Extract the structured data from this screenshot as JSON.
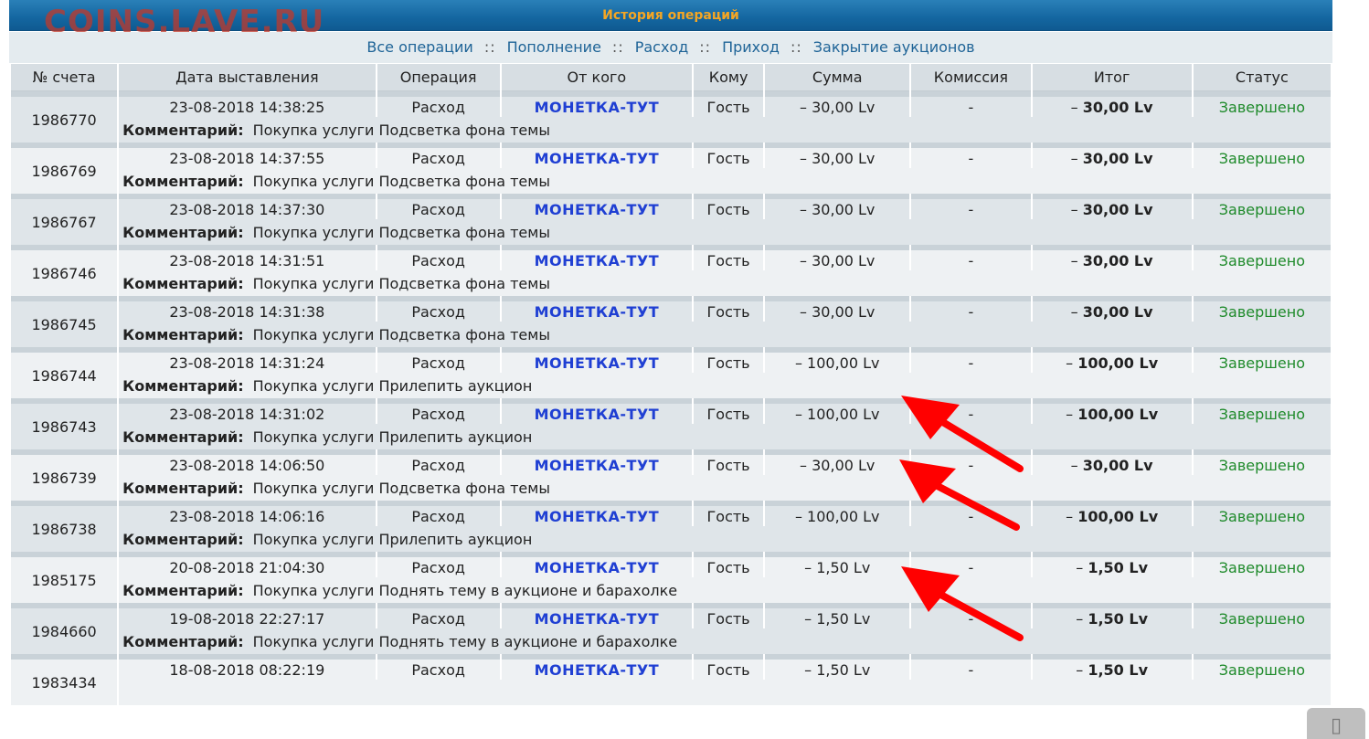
{
  "window": {
    "title": "История операций",
    "watermark": "COINS.LAVE.RU"
  },
  "filters": [
    {
      "label": "Все операции"
    },
    {
      "label": "Пополнение"
    },
    {
      "label": "Расход"
    },
    {
      "label": "Приход"
    },
    {
      "label": "Закрытие аукционов"
    }
  ],
  "filter_separator": "::",
  "columns": [
    "№ счета",
    "Дата выставления",
    "Операция",
    "От кого",
    "Кому",
    "Сумма",
    "Комиссия",
    "Итог",
    "Статус"
  ],
  "comment_label": "Комментарий:",
  "rows": [
    {
      "account": "1986770",
      "date": "23-08-2018 14:38:25",
      "operation": "Расход",
      "from": "МОНЕТКА-ТУТ",
      "to": "Гость",
      "amount": "– 30,00 Lv",
      "fee": "-",
      "total": "– 30,00 Lv",
      "status": "Завершено",
      "comment": "Покупка услуги Подсветка фона темы"
    },
    {
      "account": "1986769",
      "date": "23-08-2018 14:37:55",
      "operation": "Расход",
      "from": "МОНЕТКА-ТУТ",
      "to": "Гость",
      "amount": "– 30,00 Lv",
      "fee": "-",
      "total": "– 30,00 Lv",
      "status": "Завершено",
      "comment": "Покупка услуги Подсветка фона темы"
    },
    {
      "account": "1986767",
      "date": "23-08-2018 14:37:30",
      "operation": "Расход",
      "from": "МОНЕТКА-ТУТ",
      "to": "Гость",
      "amount": "– 30,00 Lv",
      "fee": "-",
      "total": "– 30,00 Lv",
      "status": "Завершено",
      "comment": "Покупка услуги Подсветка фона темы"
    },
    {
      "account": "1986746",
      "date": "23-08-2018 14:31:51",
      "operation": "Расход",
      "from": "МОНЕТКА-ТУТ",
      "to": "Гость",
      "amount": "– 30,00 Lv",
      "fee": "-",
      "total": "– 30,00 Lv",
      "status": "Завершено",
      "comment": "Покупка услуги Подсветка фона темы"
    },
    {
      "account": "1986745",
      "date": "23-08-2018 14:31:38",
      "operation": "Расход",
      "from": "МОНЕТКА-ТУТ",
      "to": "Гость",
      "amount": "– 30,00 Lv",
      "fee": "-",
      "total": "– 30,00 Lv",
      "status": "Завершено",
      "comment": "Покупка услуги Подсветка фона темы"
    },
    {
      "account": "1986744",
      "date": "23-08-2018 14:31:24",
      "operation": "Расход",
      "from": "МОНЕТКА-ТУТ",
      "to": "Гость",
      "amount": "– 100,00 Lv",
      "fee": "-",
      "total": "– 100,00 Lv",
      "status": "Завершено",
      "comment": "Покупка услуги Прилепить аукцион"
    },
    {
      "account": "1986743",
      "date": "23-08-2018 14:31:02",
      "operation": "Расход",
      "from": "МОНЕТКА-ТУТ",
      "to": "Гость",
      "amount": "– 100,00 Lv",
      "fee": "-",
      "total": "– 100,00 Lv",
      "status": "Завершено",
      "comment": "Покупка услуги Прилепить аукцион"
    },
    {
      "account": "1986739",
      "date": "23-08-2018 14:06:50",
      "operation": "Расход",
      "from": "МОНЕТКА-ТУТ",
      "to": "Гость",
      "amount": "– 30,00 Lv",
      "fee": "-",
      "total": "– 30,00 Lv",
      "status": "Завершено",
      "comment": "Покупка услуги Подсветка фона темы"
    },
    {
      "account": "1986738",
      "date": "23-08-2018 14:06:16",
      "operation": "Расход",
      "from": "МОНЕТКА-ТУТ",
      "to": "Гость",
      "amount": "– 100,00 Lv",
      "fee": "-",
      "total": "– 100,00 Lv",
      "status": "Завершено",
      "comment": "Покупка услуги Прилепить аукцион"
    },
    {
      "account": "1985175",
      "date": "20-08-2018 21:04:30",
      "operation": "Расход",
      "from": "МОНЕТКА-ТУТ",
      "to": "Гость",
      "amount": "– 1,50 Lv",
      "fee": "-",
      "total": "– 1,50 Lv",
      "status": "Завершено",
      "comment": "Покупка услуги Поднять тему в аукционе и барахолке"
    },
    {
      "account": "1984660",
      "date": "19-08-2018 22:27:17",
      "operation": "Расход",
      "from": "МОНЕТКА-ТУТ",
      "to": "Гость",
      "amount": "– 1,50 Lv",
      "fee": "-",
      "total": "– 1,50 Lv",
      "status": "Завершено",
      "comment": "Покупка услуги Поднять тему в аукционе и барахолке"
    },
    {
      "account": "1983434",
      "date": "18-08-2018 08:22:19",
      "operation": "Расход",
      "from": "МОНЕТКА-ТУТ",
      "to": "Гость",
      "amount": "– 1,50 Lv",
      "fee": "-",
      "total": "– 1,50 Lv",
      "status": "Завершено",
      "comment": ""
    }
  ],
  "colors": {
    "header_bar": "#1466a0",
    "title": "#f5a623",
    "link": "#1f6497",
    "sender": "#1f3fd3",
    "status": "#1e8a2a",
    "arrow": "#ff0000"
  }
}
